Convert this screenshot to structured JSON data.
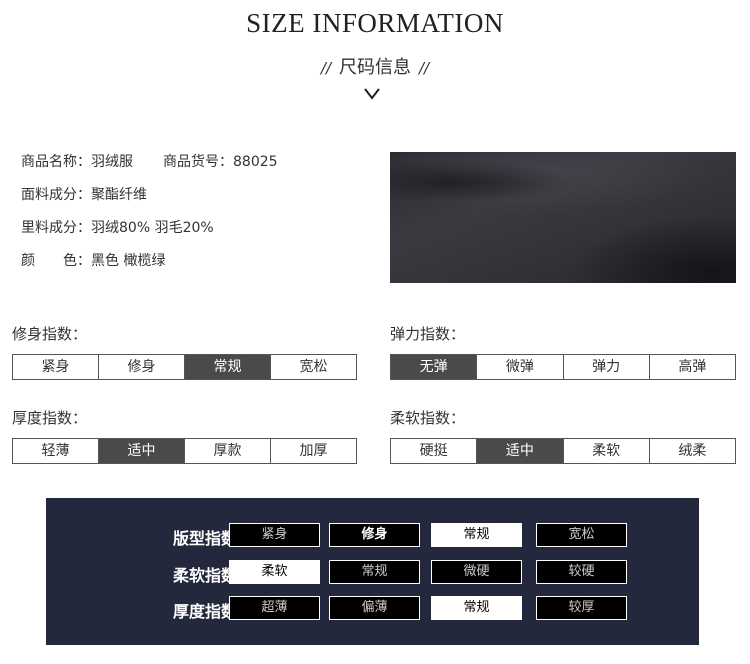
{
  "header": {
    "title": "SIZE INFORMATION",
    "subtitle": "尺码信息",
    "subtitle_decoration": "//",
    "chevron_icon": "chevron-down"
  },
  "product_info": {
    "name_label": "商品名称：",
    "name_value": "羽绒服",
    "sku_label": "商品货号：",
    "sku_value": "88025",
    "fabric_label": "面料成分：",
    "fabric_value": "聚酯纤维",
    "lining_label": "里料成分：",
    "lining_value": "羽绒80% 羽毛20%",
    "color_label_1": "颜",
    "color_label_2": "色：",
    "color_value": "黑色 橄榄绿"
  },
  "fabric_image": {
    "alt": "black fabric texture"
  },
  "indices": [
    {
      "label": "修身指数：",
      "options": [
        "紧身",
        "修身",
        "常规",
        "宽松"
      ],
      "selected": 2
    },
    {
      "label": "弹力指数：",
      "options": [
        "无弹",
        "微弹",
        "弹力",
        "高弹"
      ],
      "selected": 0
    },
    {
      "label": "厚度指数：",
      "options": [
        "轻薄",
        "适中",
        "厚款",
        "加厚"
      ],
      "selected": 1
    },
    {
      "label": "柔软指数：",
      "options": [
        "硬挺",
        "适中",
        "柔软",
        "绒柔"
      ],
      "selected": 1
    }
  ],
  "panel": {
    "rows": [
      {
        "label": "版型指数：",
        "options": [
          "紧身",
          "修身",
          "常规",
          "宽松"
        ],
        "selected": 2,
        "bold_option": 1
      },
      {
        "label": "柔软指数：",
        "options": [
          "柔软",
          "常规",
          "微硬",
          "较硬"
        ],
        "selected": 0
      },
      {
        "label": "厚度指数：",
        "options": [
          "超薄",
          "偏薄",
          "常规",
          "较厚"
        ],
        "selected": 2
      }
    ]
  },
  "colors": {
    "panel_bg": "#23283d",
    "active_cell": "#4a4a4a"
  }
}
